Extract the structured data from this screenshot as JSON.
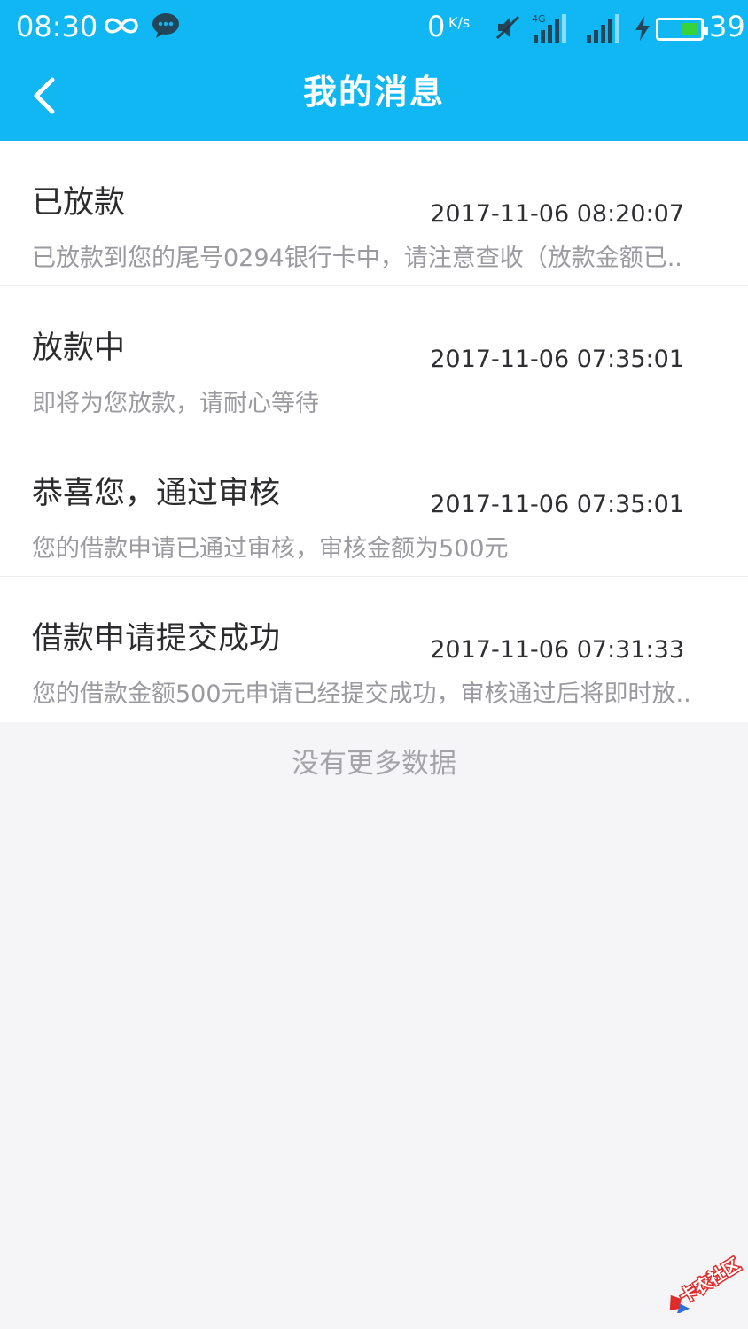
{
  "status_bar": {
    "time": "08:30",
    "network_speed": "0",
    "network_unit": "K/s",
    "network_type": "4G",
    "battery_level": "39",
    "icons": [
      "infinity-icon",
      "wechat-icon",
      "mute-icon",
      "signal-4g-icon",
      "signal-icon",
      "charging-icon",
      "battery-icon"
    ]
  },
  "header": {
    "title": "我的消息",
    "back_icon": "chevron-left-icon"
  },
  "messages": [
    {
      "title": "已放款",
      "time": "2017-11-06 08:20:07",
      "preview": "已放款到您的尾号0294银行卡中，请注意查收（放款金额已.."
    },
    {
      "title": "放款中",
      "time": "2017-11-06 07:35:01",
      "preview": "即将为您放款，请耐心等待"
    },
    {
      "title": "恭喜您，通过审核",
      "time": "2017-11-06 07:35:01",
      "preview": "您的借款申请已通过审核，审核金额为500元"
    },
    {
      "title": "借款申请提交成功",
      "time": "2017-11-06 07:31:33",
      "preview": "您的借款金额500元申请已经提交成功，审核通过后将即时放.."
    }
  ],
  "footer": {
    "no_more_text": "没有更多数据"
  },
  "watermark": {
    "text": "卡农社区"
  },
  "colors": {
    "header_bg": "#10b7f3",
    "page_bg": "#f5f5f7",
    "battery_fill": "#37d33c",
    "watermark_red": "#e02b2b"
  }
}
